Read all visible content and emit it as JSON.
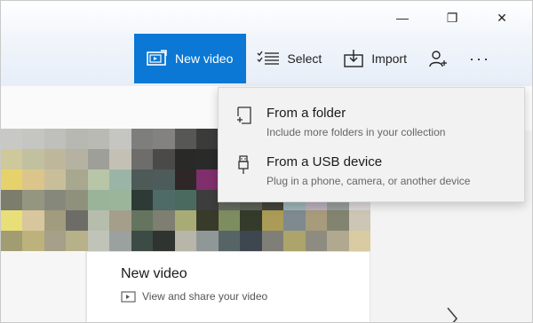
{
  "window": {
    "controls": {
      "minimize": "—",
      "restore": "❐",
      "close": "✕"
    }
  },
  "toolbar": {
    "new_video_label": "New video",
    "select_label": "Select",
    "import_label": "Import",
    "more_label": "···"
  },
  "dropdown": {
    "items": [
      {
        "title": "From a folder",
        "subtitle": "Include more folders in your collection"
      },
      {
        "title": "From a USB device",
        "subtitle": "Plug in a phone, camera, or another device"
      }
    ]
  },
  "card": {
    "title": "New video",
    "subtitle": "View and share your video"
  },
  "colors": {
    "accent": "#0a78d4",
    "mosaic": [
      [
        "#c8c9c4",
        "#c5c5c2",
        "#bfc0bc",
        "#b7b8b2",
        "#b9bab3",
        "#c5c6c1",
        "#7e7f7c",
        "#838280",
        "#575756",
        "#3b3b3a",
        "#303030",
        "#323232",
        "#505050",
        "#d1d1cd",
        "#e4e4e2",
        "#f2f2f2",
        "#fafafa"
      ],
      [
        "#cfc89a",
        "#c2c19f",
        "#bfb79c",
        "#b5b2a2",
        "#9e9f98",
        "#c4c1b4",
        "#6f6d6c",
        "#4a4a49",
        "#292929",
        "#2a2a2a",
        "#2a2a2a",
        "#2d2d2d",
        "#3a3a3a",
        "#5f6059",
        "#aaa9a3",
        "#bdbdb8",
        "#f2f2f2"
      ],
      [
        "#e6d26b",
        "#dcc58a",
        "#c8bf9a",
        "#a7a88f",
        "#b9c5a7",
        "#9ab5a8",
        "#4d5a57",
        "#4e5b5b",
        "#2f2727",
        "#7e2f6c",
        "#6e5541",
        "#4f5238",
        "#6b5a44",
        "#76704a",
        "#d6c77d",
        "#a3a7a0",
        "#f0efe8"
      ],
      [
        "#7c7d6d",
        "#94967f",
        "#86887b",
        "#90917c",
        "#9ab49a",
        "#9bb59b",
        "#2e3a36",
        "#4e6b67",
        "#4a6a60",
        "#3d3d3d",
        "#646a5d",
        "#5a6155",
        "#43443d",
        "#9bb3b4",
        "#b8b0bd",
        "#989e9b",
        "#dcd6d8"
      ],
      [
        "#e9df79",
        "#d8c79c",
        "#a19c7d",
        "#6e6c67",
        "#b7bdad",
        "#a59e8a",
        "#65745f",
        "#7e7e71",
        "#a9ab77",
        "#383a2a",
        "#7e8d60",
        "#353b2a",
        "#aa9c56",
        "#7e8a8e",
        "#a89b7c",
        "#83846f",
        "#cdc6b4"
      ],
      [
        "#a19c72",
        "#bdb27c",
        "#a6a08a",
        "#b7b18a",
        "#c0c4b8",
        "#9aa19e",
        "#3c4b45",
        "#2f3431",
        "#b7b6a8",
        "#8f9896",
        "#566465",
        "#3e4650",
        "#7f7f78",
        "#aca46b",
        "#8e8c80",
        "#b0a88f",
        "#d9cba2"
      ]
    ]
  }
}
